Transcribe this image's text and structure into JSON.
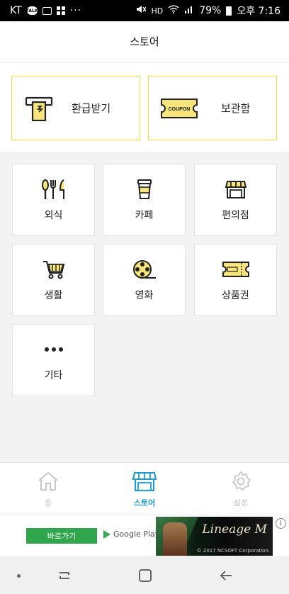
{
  "status_bar": {
    "carrier": "KT",
    "talk_badge": "TALK",
    "more": "···",
    "hd": "HD",
    "battery": "79%",
    "time": "오후 7:16"
  },
  "header": {
    "title": "스토어"
  },
  "top_cards": [
    {
      "label": "환급받기",
      "icon": "refund-atm-icon"
    },
    {
      "label": "보관함",
      "icon": "coupon-ticket-icon",
      "icon_text": "COUPON"
    }
  ],
  "categories": [
    {
      "label": "외식",
      "icon": "utensils-icon"
    },
    {
      "label": "카페",
      "icon": "coffee-cup-icon"
    },
    {
      "label": "편의점",
      "icon": "store-icon"
    },
    {
      "label": "생활",
      "icon": "shopping-cart-icon"
    },
    {
      "label": "영화",
      "icon": "film-reel-icon"
    },
    {
      "label": "상품권",
      "icon": "gift-voucher-icon"
    },
    {
      "label": "기타",
      "icon": "more-dots-icon"
    }
  ],
  "bottom_nav": [
    {
      "label": "홈",
      "icon": "home-icon",
      "active": false
    },
    {
      "label": "스토어",
      "icon": "store-icon",
      "active": true
    },
    {
      "label": "설정",
      "icon": "gear-icon",
      "active": false
    }
  ],
  "ad": {
    "button_label": "바로가기",
    "store_label": "Google Play",
    "logo_text": "Lineage M",
    "copyright": "© 2017 NCSOFT Corporation.",
    "info": "i"
  },
  "colors": {
    "accent_yellow": "#f0df3b",
    "icon_yellow": "#f7e47a",
    "active_blue": "#1a9cd8",
    "ad_green": "#2fa64c"
  }
}
